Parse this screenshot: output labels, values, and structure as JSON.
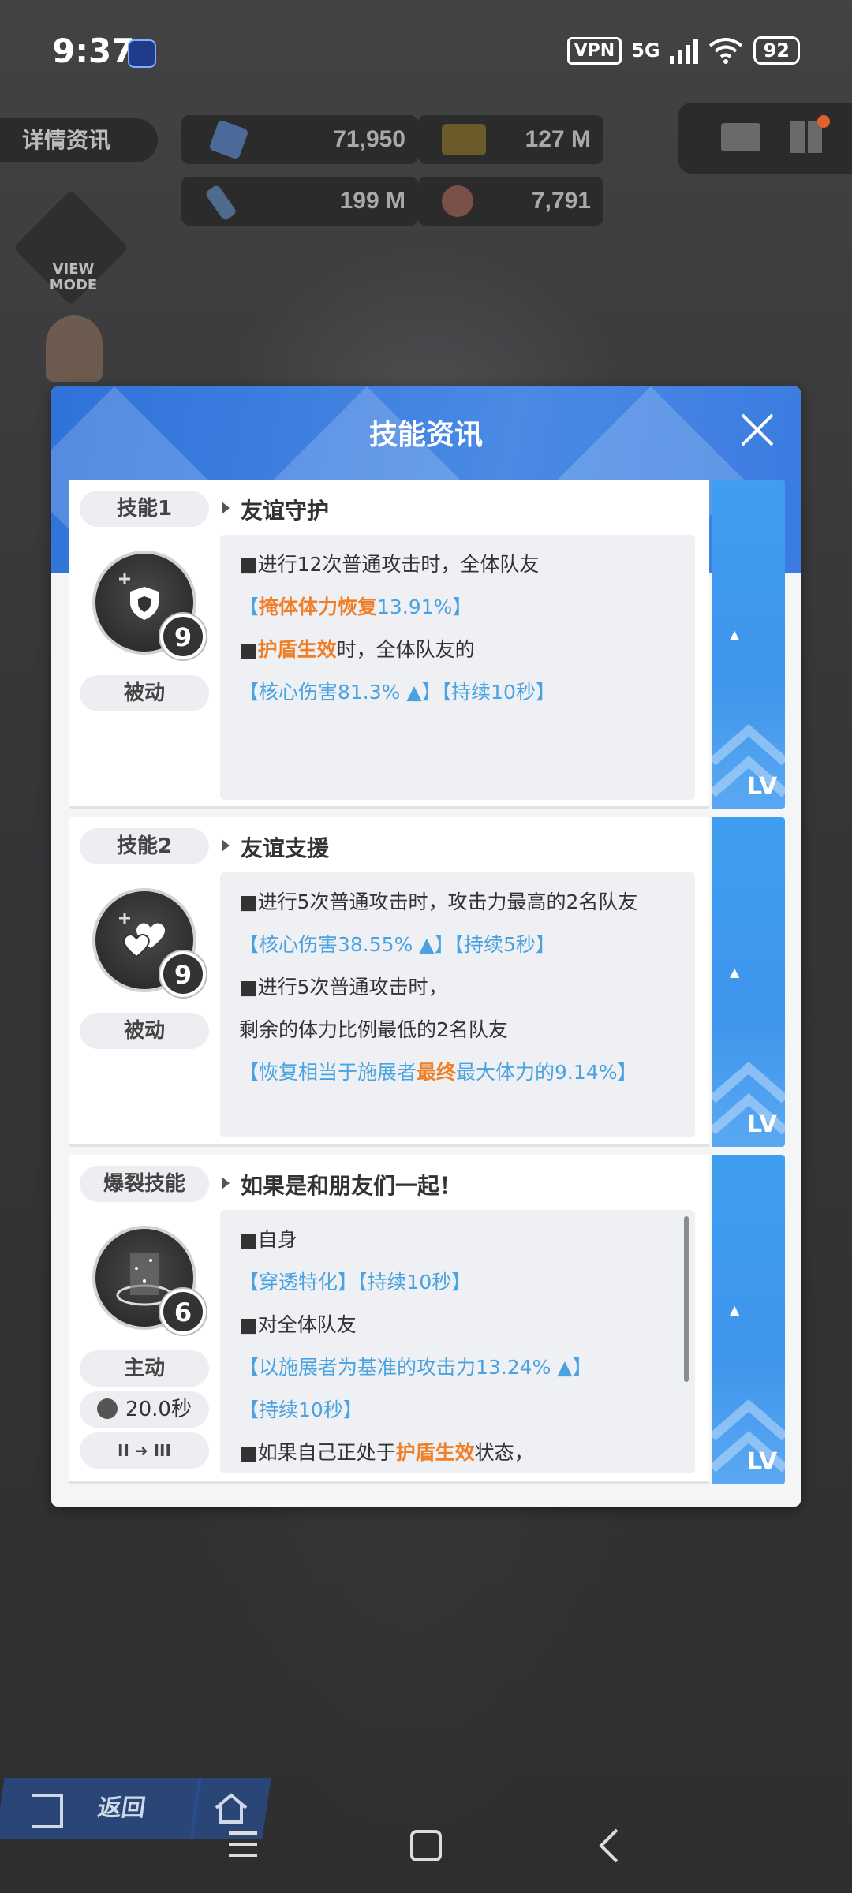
{
  "status_bar": {
    "time": "9:37",
    "vpn": "VPN",
    "network": "5G",
    "battery": "92"
  },
  "top_bar": {
    "detail_label": "详情资讯",
    "resources": [
      {
        "icon": "gem-icon",
        "value": "71,950"
      },
      {
        "icon": "credit-icon",
        "value": "127 M"
      },
      {
        "icon": "material-icon",
        "value": "199 M"
      },
      {
        "icon": "core-icon",
        "value": "7,791"
      }
    ],
    "view_mode": "VIEW MODE"
  },
  "panel": {
    "title": "技能资讯",
    "skills": [
      {
        "tag": "技能1",
        "name": "友谊守护",
        "type": "被动",
        "level": "9",
        "lines": [
          {
            "prefix": "■进行12次普通攻击时，全体队友"
          },
          {
            "pre": "【",
            "hl": "掩体体力恢复",
            "post": "13.91%】"
          },
          {
            "prefix": "■",
            "hl": "护盾生效",
            "post": "时，全体队友的"
          },
          {
            "text": "【核心伤害81.3% ▲】【持续10秒】"
          }
        ],
        "lv_label": "LV"
      },
      {
        "tag": "技能2",
        "name": "友谊支援",
        "type": "被动",
        "level": "9",
        "lines": [
          {
            "prefix": "■进行5次普通攻击时，攻击力最高的2名队友"
          },
          {
            "text": "【核心伤害38.55% ▲】【持续5秒】"
          },
          {
            "prefix": "■进行5次普通攻击时，"
          },
          {
            "prefix": "剩余的体力比例最低的2名队友"
          },
          {
            "pre": "【恢复相当于施展者",
            "hl": "最终",
            "post": "最大体力的9.14%】"
          }
        ],
        "lv_label": "LV"
      },
      {
        "tag": "爆裂技能",
        "name": "如果是和朋友们一起！",
        "type": "主动",
        "level": "6",
        "cooldown": "20.0秒",
        "burst_stage": "II ➜ III",
        "lines": [
          {
            "prefix": "■自身"
          },
          {
            "text": "【穿透特化】【持续10秒】"
          },
          {
            "prefix": "■对全体队友"
          },
          {
            "text": "【以施展者为基准的攻击力13.24% ▲】"
          },
          {
            "text": "【持续10秒】"
          },
          {
            "prefix": "■如果自己正处于",
            "hl": "护盾生效",
            "post": "状态，"
          }
        ],
        "lv_label": "LV"
      }
    ]
  },
  "bottom": {
    "back_label": "返回"
  },
  "colors": {
    "header_blue": "#3a7be0",
    "lv_blue": "#3e95ec",
    "highlight_orange": "#f07f2a",
    "info_blue": "#4aa3e0"
  }
}
